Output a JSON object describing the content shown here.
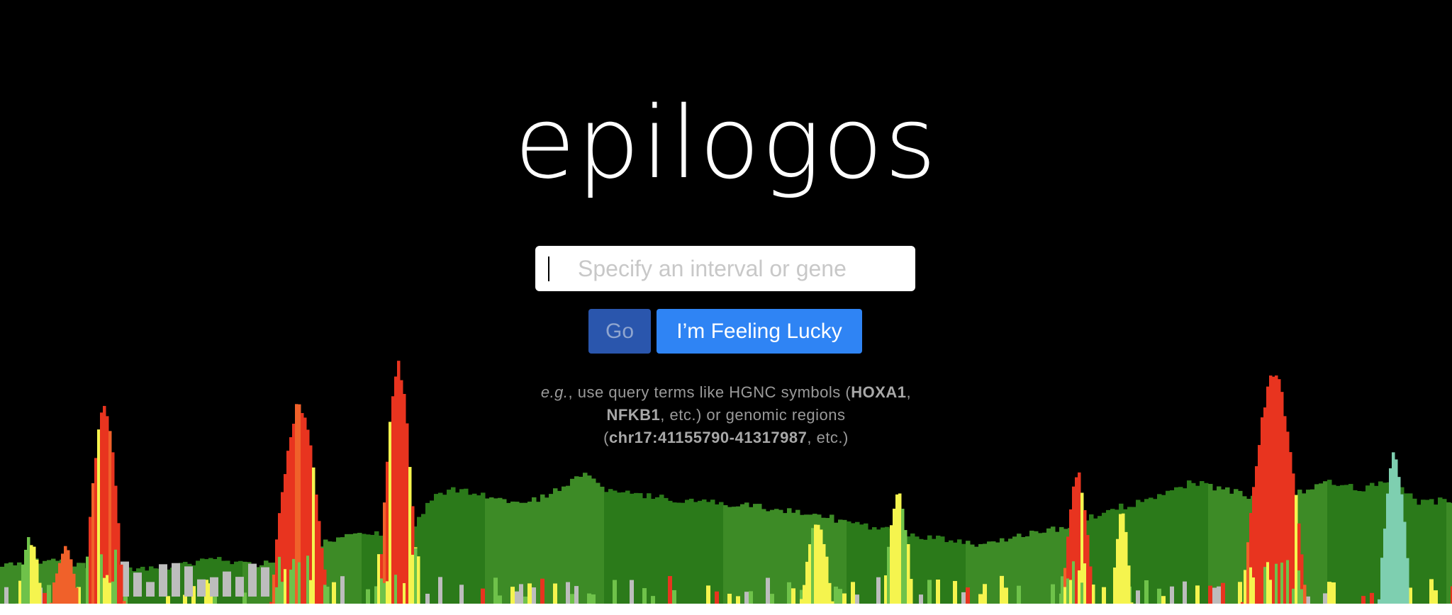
{
  "app": {
    "title": "epilogos"
  },
  "search": {
    "placeholder": "Specify an interval or gene",
    "value": ""
  },
  "buttons": {
    "go_label": "Go",
    "lucky_label": "I’m Feeling Lucky"
  },
  "hint": {
    "eg": "e.g.",
    "text1": ", use query terms like HGNC symbols (",
    "gene1": "HOXA1",
    "text2": ",",
    "gene2": "NFKB1",
    "text3": ", etc.) or genomic regions",
    "region": "chr17:41155790-41317987",
    "text4": ", etc.)"
  },
  "colors": {
    "background": "#000000",
    "go_button": "#2a56ad",
    "lucky_button": "#2f84f4",
    "viz_red": "#e8341f",
    "viz_orange": "#f0612a",
    "viz_yellow": "#f5f44e",
    "viz_dark_green": "#2b7a1a",
    "viz_mid_green": "#3d8b26",
    "viz_light_green": "#6fc24a",
    "viz_teal": "#7ecfb0",
    "viz_gray": "#bdbdbd"
  }
}
